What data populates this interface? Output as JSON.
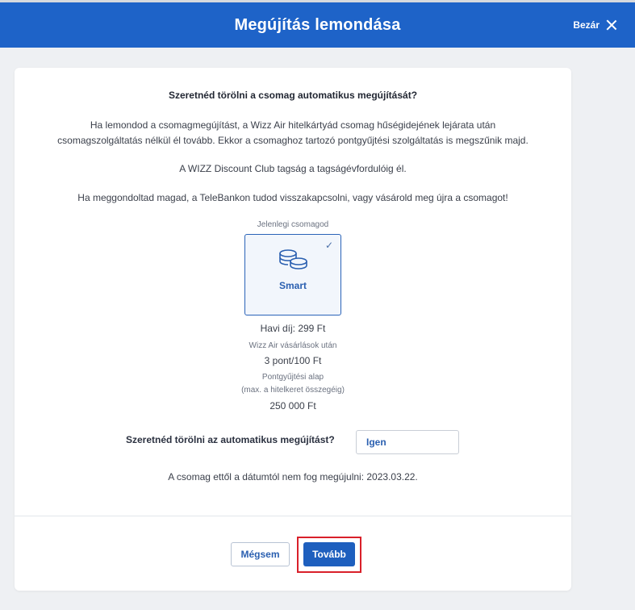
{
  "header": {
    "title": "Megújítás lemondása",
    "close_label": "Bezár"
  },
  "content": {
    "question_title": "Szeretnéd törölni a csomag automatikus megújítását?",
    "paragraph1_line1": "Ha lemondod a csomagmegújítást, a Wizz Air hitelkártyád csomag hűségidejének lejárata után",
    "paragraph1_line2": "csomagszolgáltatás nélkül él tovább. Ekkor a csomaghoz tartozó pontgyűjtési szolgáltatás is megszűnik majd.",
    "paragraph2": "A WIZZ Discount Club tagság a tagságévfordulóig él.",
    "paragraph3": "Ha meggondoltad magad, a TeleBankon tudod visszakapcsolni, vagy vásárold meg újra a csomagot!"
  },
  "package": {
    "current_label": "Jelenlegi csomagod",
    "name": "Smart",
    "icon": "coins-icon",
    "check_icon": "checkmark-icon",
    "monthly_fee": "Havi díj: 299 Ft",
    "points_caption": "Wizz Air vásárlások után",
    "points_value": "3 pont/100 Ft",
    "base_caption_line1": "Pontgyűjtési alap",
    "base_caption_line2": "(max. a hitelkeret összegéig)",
    "base_value": "250 000 Ft"
  },
  "confirm": {
    "label": "Szeretnéd törölni az automatikus megújítást?",
    "selected_value": "Igen"
  },
  "date_note": "A csomag ettől a dátumtól nem fog megújulni: 2023.03.22.",
  "footer": {
    "cancel_label": "Mégsem",
    "next_label": "Tovább"
  },
  "colors": {
    "header_bg": "#1e63c8",
    "primary_button": "#1e5fbe",
    "highlight_border": "#d9202a",
    "page_bg": "#eef0f3"
  }
}
